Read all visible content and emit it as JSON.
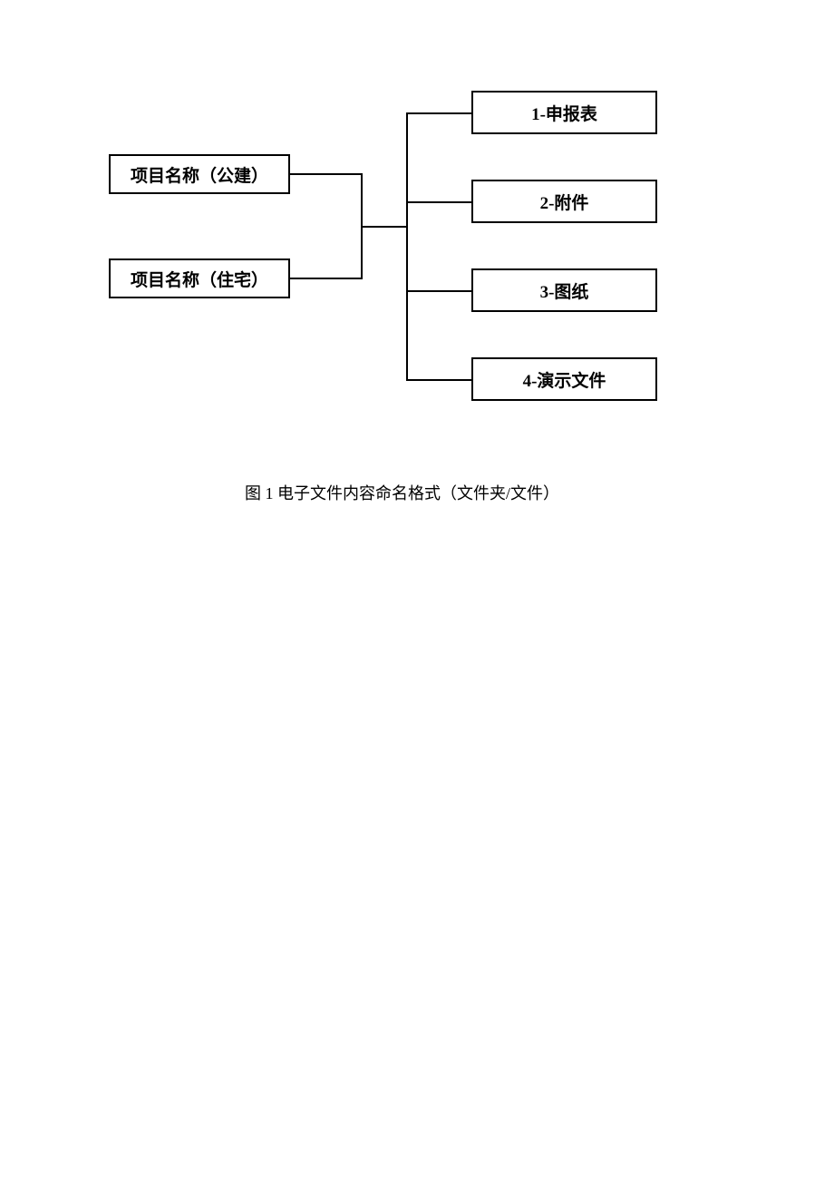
{
  "diagram": {
    "left_nodes": [
      {
        "label": "项目名称（公建）"
      },
      {
        "label": "项目名称（住宅）"
      }
    ],
    "right_nodes": [
      {
        "label": "1-申报表"
      },
      {
        "label": "2-附件"
      },
      {
        "label": "3-图纸"
      },
      {
        "label": "4-演示文件"
      }
    ]
  },
  "caption": "图 1 电子文件内容命名格式（文件夹/文件）"
}
